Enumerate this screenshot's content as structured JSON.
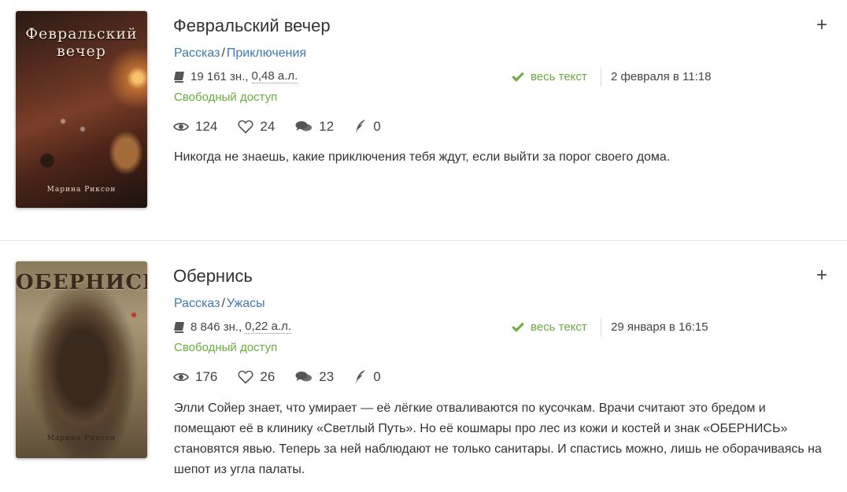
{
  "books": [
    {
      "cover": {
        "title": "Февральский вечер",
        "author": "Марина Риксон"
      },
      "title": "Февральский вечер",
      "genre": "Рассказ",
      "subgenre": "Приключения",
      "chars": "19 161 зн.,",
      "al": "0,48 а.л.",
      "access": "Свободный доступ",
      "fulltext": "весь текст",
      "date": "2 февраля в 11:18",
      "views": "124",
      "likes": "24",
      "comments": "12",
      "rewards": "0",
      "description": "Никогда не знаешь, какие приключения тебя ждут, если выйти за порог своего дома."
    },
    {
      "cover": {
        "title": "ОБЕРНИСЬ",
        "author": "Марина Риксон"
      },
      "title": "Обернись",
      "genre": "Рассказ",
      "subgenre": "Ужасы",
      "chars": "8 846 зн.,",
      "al": "0,22 а.л.",
      "access": "Свободный доступ",
      "fulltext": "весь текст",
      "date": "29 января в 16:15",
      "views": "176",
      "likes": "26",
      "comments": "23",
      "rewards": "0",
      "description": "Элли Сойер знает, что умирает — её лёгкие отваливаются по кусочкам. Врачи считают это бредом и помещают её в клинику «Светлый Путь». Но её кошмары про лес из кожи и костей и знак «ОБЕРНИСЬ» становятся явью. Теперь за ней наблюдают не только санитары. И спастись можно, лишь не оборачиваясь на шепот из угла палаты."
    }
  ],
  "add_symbol": "+",
  "genre_separator": "/",
  "colors": {
    "link": "#3f7ab4",
    "green": "#68ad3f",
    "text": "#333333"
  },
  "icons": [
    "book-icon",
    "check-icon",
    "eye-icon",
    "heart-icon",
    "comments-icon",
    "quill-icon",
    "plus-icon"
  ]
}
